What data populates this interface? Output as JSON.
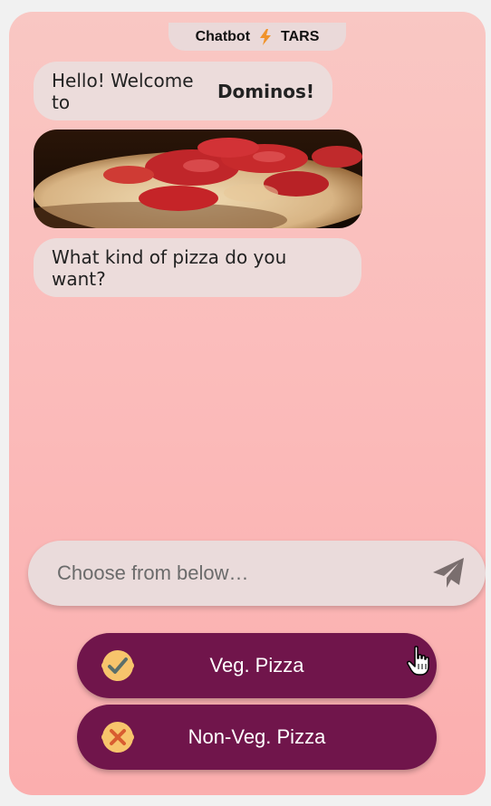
{
  "header": {
    "left": "Chatbot",
    "right": "TARS"
  },
  "messages": {
    "greeting_prefix": "Hello! Welcome to",
    "greeting_brand": "Dominos!",
    "question": "What kind of pizza do you want?"
  },
  "input": {
    "placeholder": "Choose from below…"
  },
  "options": [
    {
      "label": "Veg. Pizza",
      "icon": "check-icon"
    },
    {
      "label": "Non-Veg. Pizza",
      "icon": "cross-icon"
    }
  ],
  "colors": {
    "option_bg": "#70154b",
    "bubble_bg": "#ecdcdb",
    "bolt": "#f0932b",
    "badge": "#f7c46c"
  }
}
